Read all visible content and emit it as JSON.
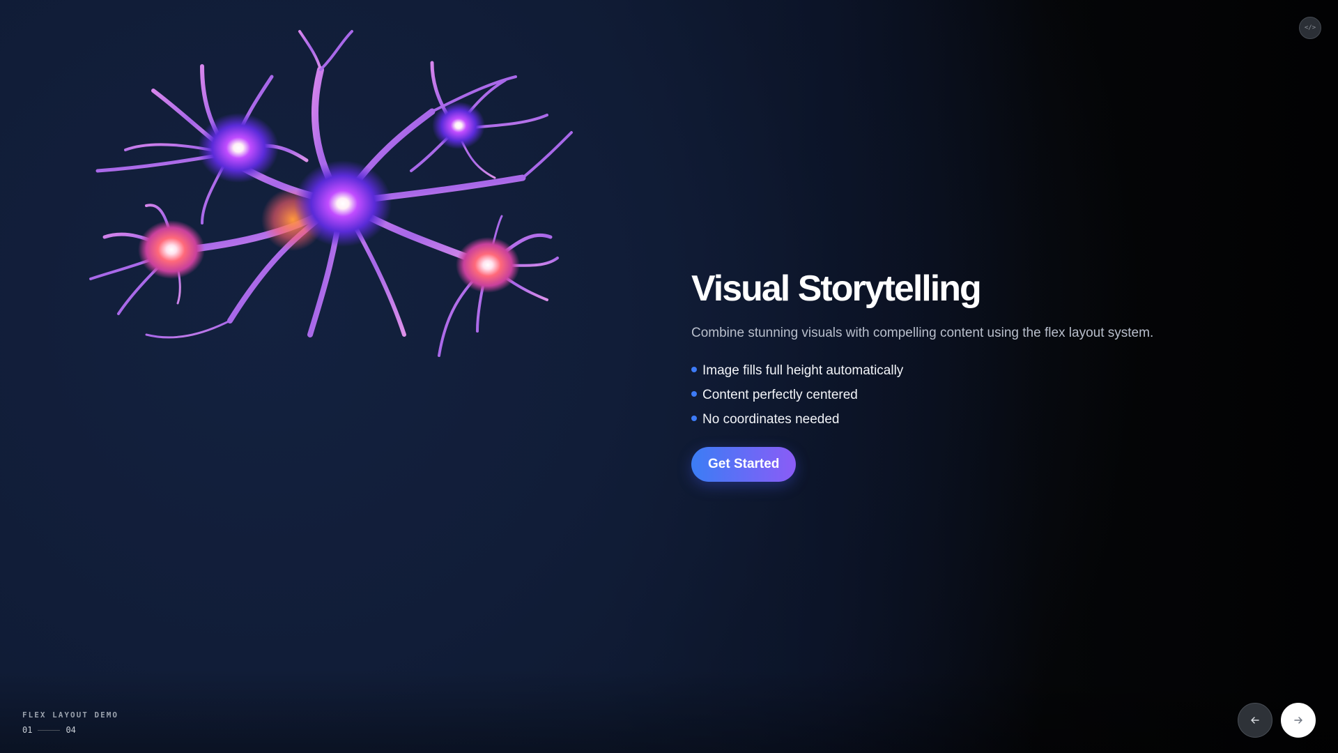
{
  "hero": {
    "image_icon": "neuron-network-illustration"
  },
  "content": {
    "title": "Visual Storytelling",
    "description": "Combine stunning visuals with compelling content using the flex layout system.",
    "features": [
      "Image fills full height automatically",
      "Content perfectly centered",
      "No coordinates needed"
    ],
    "cta_label": "Get Started"
  },
  "toolbar": {
    "code_toggle_label": "</>",
    "code_toggle_icon": "code-icon"
  },
  "deck": {
    "title": "FLEX LAYOUT DEMO",
    "current_page": "01",
    "total_pages": "04"
  },
  "nav": {
    "prev_icon": "arrow-left-icon",
    "next_icon": "arrow-right-icon"
  },
  "colors": {
    "accent_blue": "#3b7df5",
    "accent_purple": "#8b5cf6",
    "background": "#0f1c36"
  }
}
